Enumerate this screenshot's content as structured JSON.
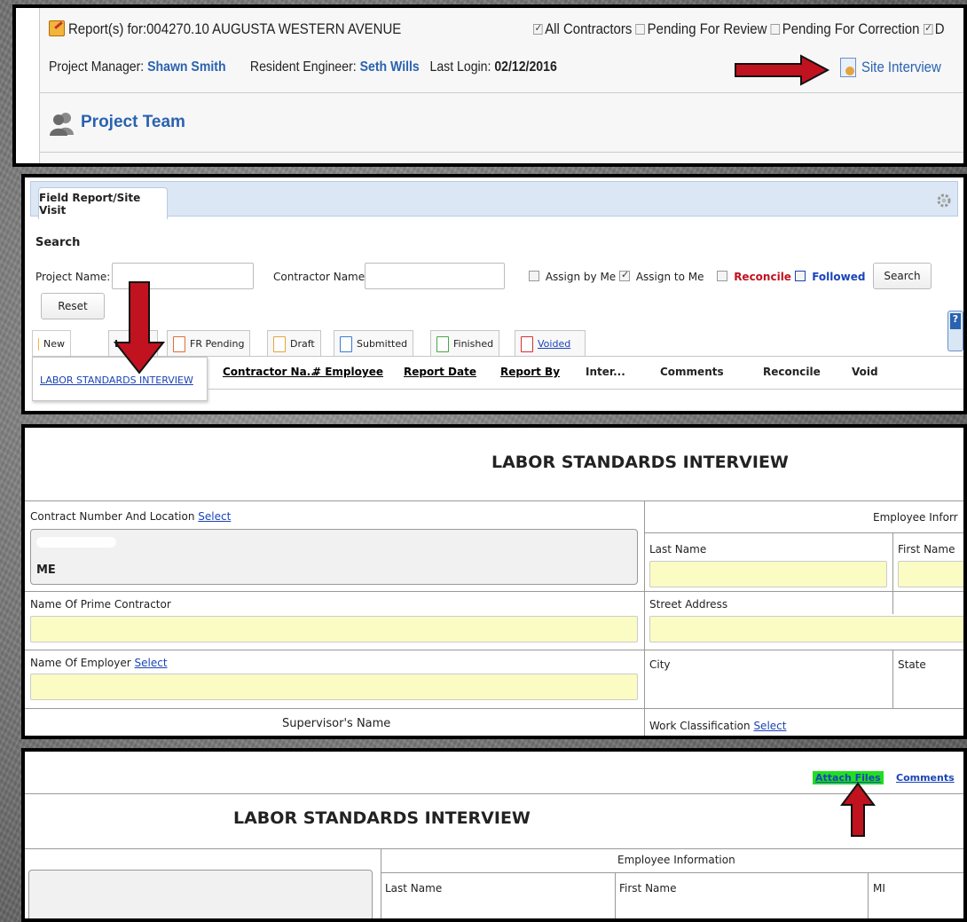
{
  "panel1": {
    "report_label": "Report(s) for:004270.10 AUGUSTA WESTERN AVENUE",
    "filters": [
      {
        "label": "All Contractors",
        "checked": true
      },
      {
        "label": "Pending For Review",
        "checked": false
      },
      {
        "label": "Pending For Correction",
        "checked": false
      },
      {
        "label": "D",
        "checked": true
      }
    ],
    "pm_label": "Project Manager:",
    "pm_name": "Shawn Smith",
    "re_label": "Resident Engineer:",
    "re_name": "Seth Wills",
    "login_label": "Last Login:",
    "login_date": "02/12/2016",
    "site_interview": "Site Interview",
    "project_team": "Project Team"
  },
  "panel2": {
    "tab_title": "Field Report/Site Visit",
    "search_heading": "Search",
    "project_name_label": "Project Name:",
    "contractor_name_label": "Contractor Name:",
    "assign_by_me": "Assign by Me",
    "assign_to_me": "Assign to Me",
    "reconcile": "Reconcile",
    "followed": "Followed",
    "search_button": "Search",
    "reset_button": "Reset",
    "tabs": {
      "new": "New",
      "legacy": "Le",
      "legacy_tail": "s",
      "fr_pending": "FR Pending",
      "draft": "Draft",
      "submitted": "Submitted",
      "finished": "Finished",
      "voided": "Voided"
    },
    "dropdown_item": "LABOR STANDARDS INTERVIEW",
    "columns": {
      "contractor": "Contractor Na...",
      "employee": "# Employee",
      "report_date": "Report Date",
      "report_by": "Report By",
      "inter": "Inter...",
      "comments": "Comments",
      "reconcile": "Reconcile",
      "void": "Void"
    }
  },
  "panel3": {
    "title": "LABOR STANDARDS INTERVIEW",
    "contract_label": "Contract Number And Location",
    "select": "Select",
    "contract_value": "ME",
    "employee_info": "Employee Inforr",
    "last_name": "Last Name",
    "first_name": "First Name",
    "prime_contractor": "Name Of Prime Contractor",
    "street_address": "Street Address",
    "employer": "Name Of Employer",
    "city": "City",
    "state": "State",
    "supervisor": "Supervisor's Name",
    "work_classification": "Work Classification"
  },
  "panel4": {
    "attach_files": "Attach Files",
    "comments": "Comments",
    "title": "LABOR STANDARDS INTERVIEW",
    "employee_info": "Employee Information",
    "last_name": "Last Name",
    "first_name": "First Name",
    "mi": "MI"
  },
  "colors": {
    "arrow_red": "#c1121f",
    "link_blue": "#1a44b8",
    "name_blue": "#2a62b0",
    "field_yellow": "#fbfbc4",
    "attach_green": "#22dd22"
  }
}
